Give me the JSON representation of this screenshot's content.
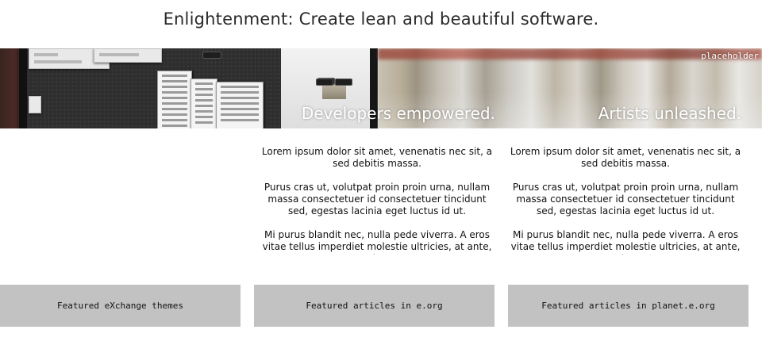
{
  "header": {
    "title": "Enlightenment: Create lean and beautiful software."
  },
  "banner": {
    "placeholder_label": "placeholder",
    "developers_tagline": "Developers empowered.",
    "artists_tagline": "Artists unleashed."
  },
  "columns": [
    {
      "paragraphs": []
    },
    {
      "paragraphs": [
        "Lorem ipsum dolor sit amet, venenatis nec sit, a sed debitis massa.",
        "Purus cras ut, volutpat proin proin urna, nullam massa consectetuer id consectetuer tincidunt sed, egestas lacinia eget luctus id ut.",
        "Mi purus blandit nec, nulla pede viverra. A eros vitae tellus imperdiet molestie ultricies, at ante, in"
      ]
    },
    {
      "paragraphs": [
        "Lorem ipsum dolor sit amet, venenatis nec sit, a sed debitis massa.",
        "Purus cras ut, volutpat proin proin urna, nullam massa consectetuer id consectetuer tincidunt sed, egestas lacinia eget luctus id ut.",
        "Mi purus blandit nec, nulla pede viverra. A eros vitae tellus imperdiet molestie ultricies, at ante, in"
      ]
    }
  ],
  "featured": [
    {
      "label": "Featured eXchange themes"
    },
    {
      "label": "Featured articles in e.org"
    },
    {
      "label": "Featured articles in planet.e.org"
    }
  ],
  "colors": {
    "button_bg": "#c2c2c2",
    "banner_dark": "#2b2b2b"
  }
}
